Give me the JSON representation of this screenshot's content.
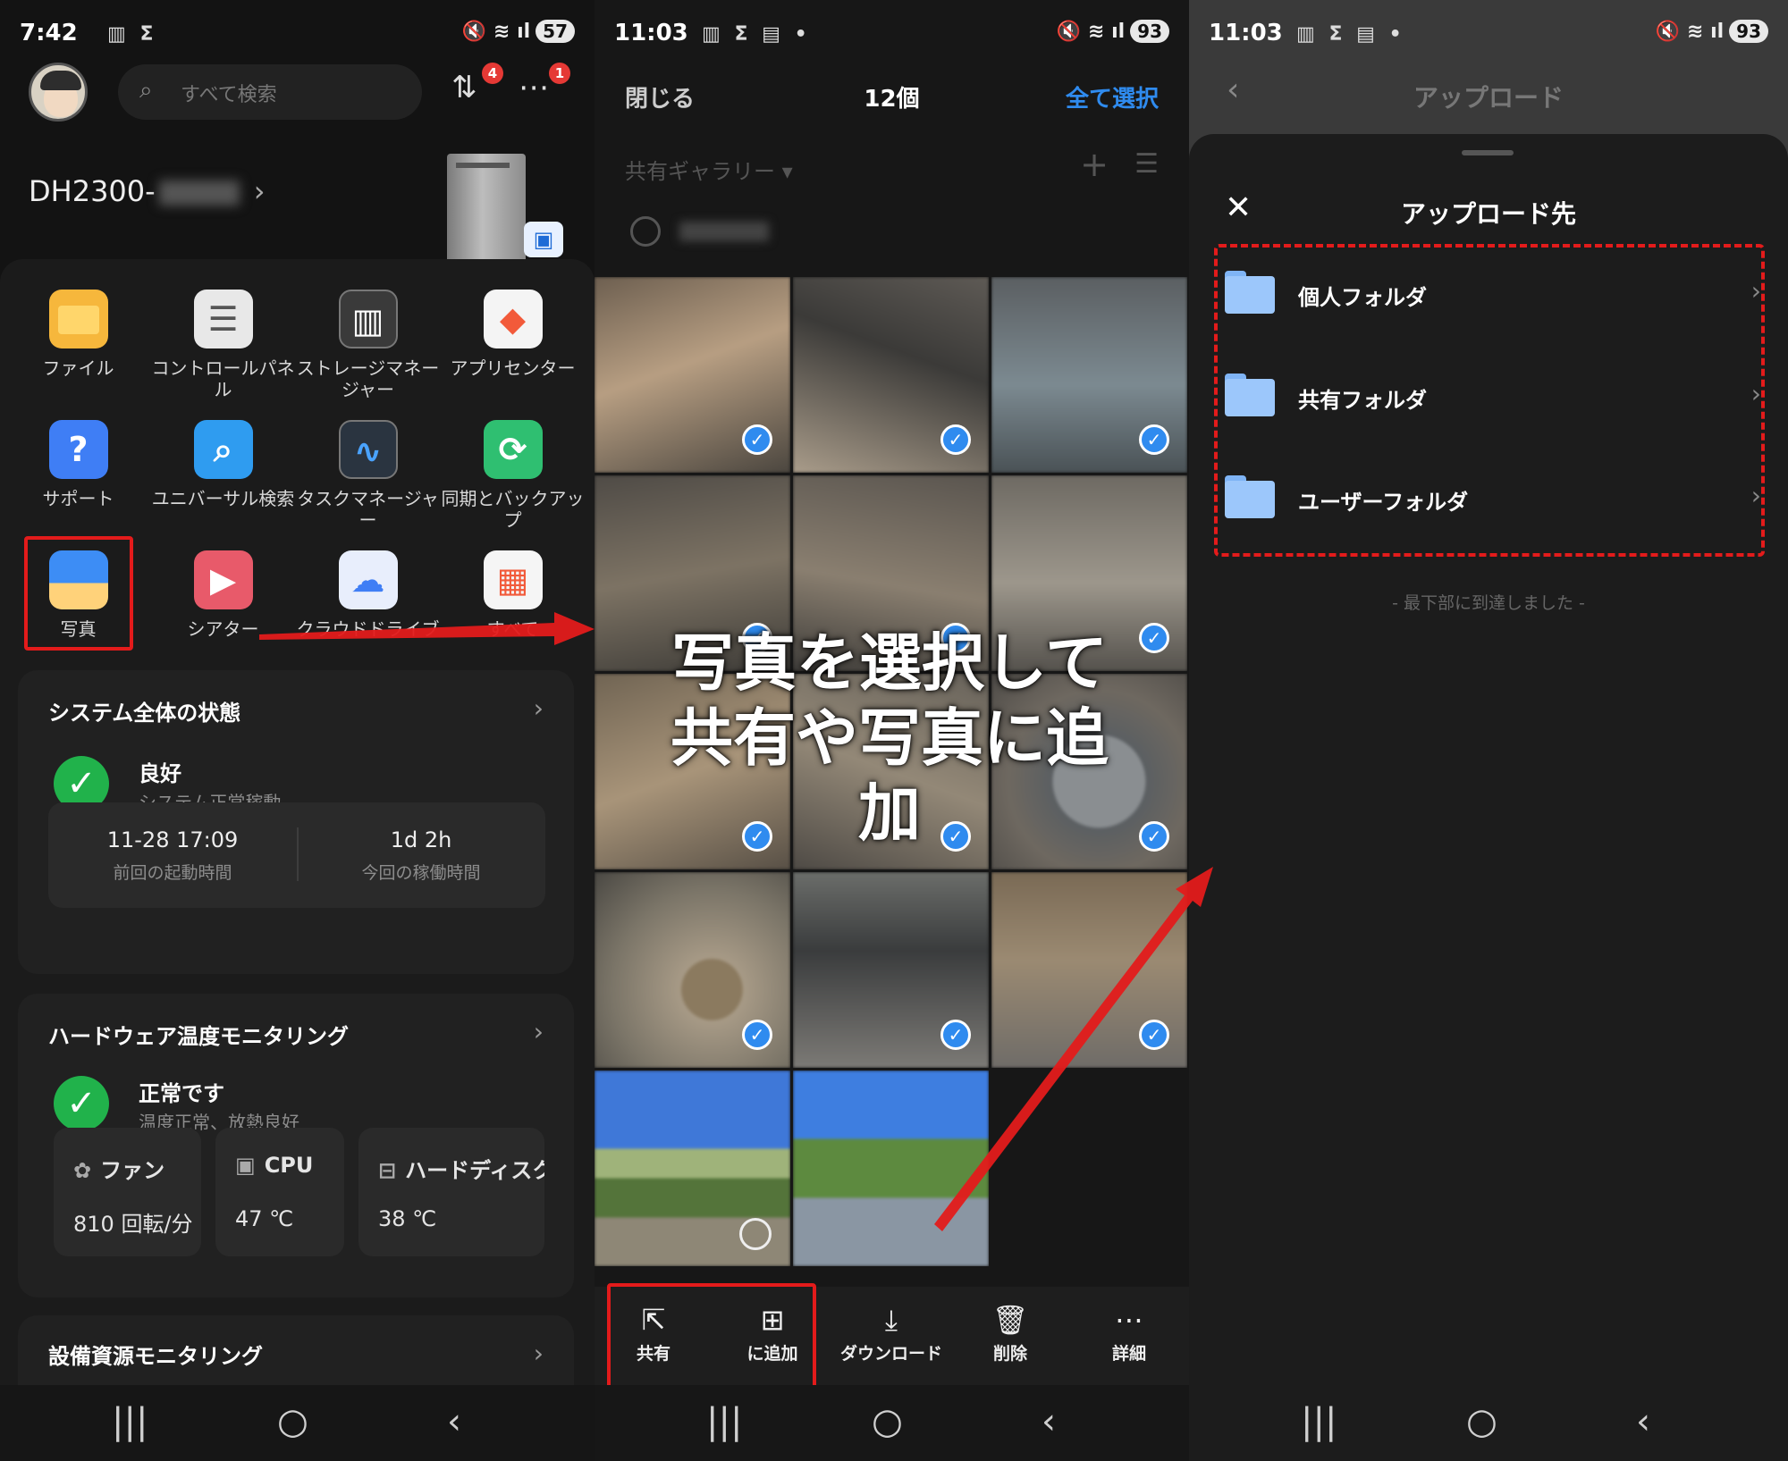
{
  "p1": {
    "status": {
      "time": "7:42",
      "battery": "57"
    },
    "search_placeholder": "すべて検索",
    "badges": {
      "transfer": "4",
      "messages": "1"
    },
    "device_name": "DH2300-",
    "apps": [
      {
        "label": "ファイル",
        "color": "#f6b73c",
        "glyph": ""
      },
      {
        "label": "コントロールパネル",
        "color": "#e8e8e8",
        "glyph": "☰"
      },
      {
        "label": "ストレージマネージャー",
        "color": "#3a3a3a",
        "glyph": "▥"
      },
      {
        "label": "アプリセンター",
        "color": "#f4f4f4",
        "glyph": "◆"
      },
      {
        "label": "サポート",
        "color": "#3f7ef5",
        "glyph": "?"
      },
      {
        "label": "ユニバーサル検索",
        "color": "#2f9cf0",
        "glyph": "⌕"
      },
      {
        "label": "タスクマネージャー",
        "color": "#2a3440",
        "glyph": "∿"
      },
      {
        "label": "同期とバックアップ",
        "color": "#2fbf71",
        "glyph": "⟳"
      },
      {
        "label": "写真",
        "color": "#3d8df5",
        "glyph": ""
      },
      {
        "label": "シアター",
        "color": "#e85a6a",
        "glyph": "▶"
      },
      {
        "label": "クラウドドライブ",
        "color": "#e8eefc",
        "glyph": "☁"
      },
      {
        "label": "すべて",
        "color": "#f5f5f5",
        "glyph": "▦"
      }
    ],
    "system": {
      "title": "システム全体の状態",
      "status": "良好",
      "status_sub": "システム正常稼動",
      "boot_time": "11-28 17:09",
      "boot_label": "前回の起動時間",
      "uptime": "1d 2h",
      "uptime_label": "今回の稼働時間"
    },
    "hardware": {
      "title": "ハードウェア温度モニタリング",
      "status": "正常です",
      "status_sub": "温度正常、放熱良好",
      "items": [
        {
          "name": "ファン",
          "value": "810 回転/分",
          "icon": "fan-icon"
        },
        {
          "name": "CPU",
          "value": "47 ℃",
          "icon": "cpu-icon"
        },
        {
          "name": "ハードディスク",
          "value": "38 ℃",
          "icon": "disk-icon"
        }
      ]
    },
    "resource_title": "設備資源モニタリング"
  },
  "p2": {
    "status": {
      "time": "11:03",
      "battery": "93"
    },
    "close_label": "閉じる",
    "count": "12個",
    "select_all": "全て選択",
    "gallery": "共有ギャラリー",
    "overlay": "写真を選択して共有や写真に追加",
    "actions": [
      {
        "label": "共有",
        "icon": "share-icon"
      },
      {
        "label": "に追加",
        "icon": "add-photo-icon"
      },
      {
        "label": "ダウンロード",
        "icon": "download-icon"
      },
      {
        "label": "削除",
        "icon": "trash-icon"
      },
      {
        "label": "詳細",
        "icon": "more-icon"
      }
    ]
  },
  "p3": {
    "status": {
      "time": "11:03",
      "battery": "93"
    },
    "title": "アップロード",
    "sheet_title": "アップロード先",
    "folders": [
      "個人フォルダ",
      "共有フォルダ",
      "ユーザーフォルダ"
    ],
    "end_note": "- 最下部に到達しました -"
  },
  "colors": {
    "accent": "#2f8bef",
    "highlight": "#e31b1b",
    "ok": "#21b24b"
  }
}
